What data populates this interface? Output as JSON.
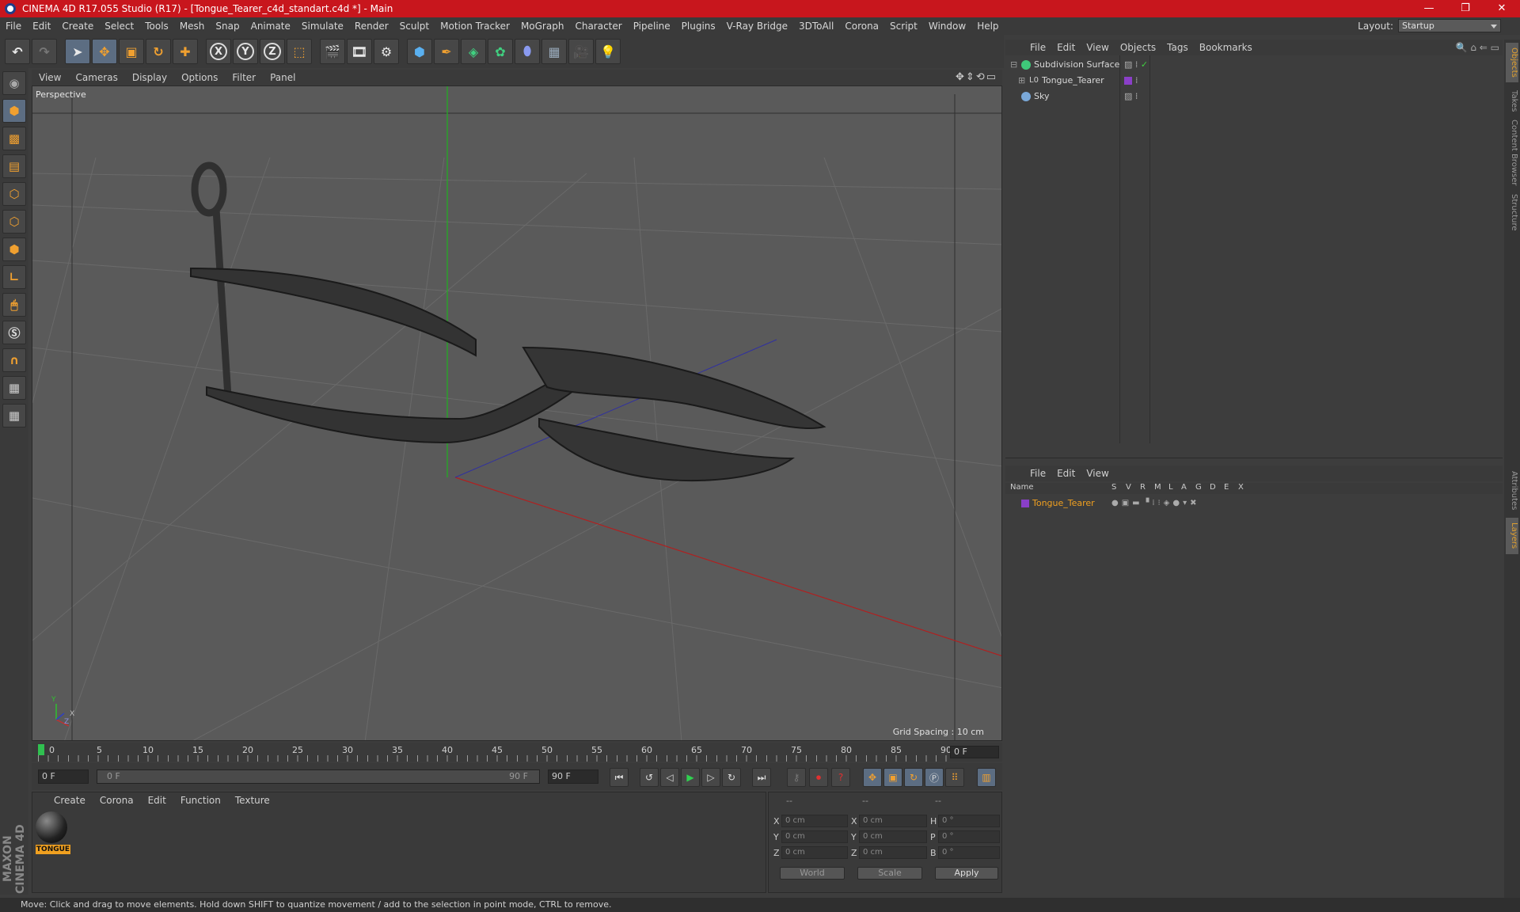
{
  "window": {
    "title": "CINEMA 4D R17.055 Studio (R17) - [Tongue_Tearer_c4d_standart.c4d *] - Main",
    "controls": [
      "—",
      "❐",
      "✕"
    ]
  },
  "menubar": {
    "items": [
      "File",
      "Edit",
      "Create",
      "Select",
      "Tools",
      "Mesh",
      "Snap",
      "Animate",
      "Simulate",
      "Render",
      "Sculpt",
      "Motion Tracker",
      "MoGraph",
      "Character",
      "Pipeline",
      "Plugins",
      "V-Ray Bridge",
      "3DToAll",
      "Corona",
      "Script",
      "Window",
      "Help"
    ],
    "layout_label": "Layout:",
    "layout_value": "Startup"
  },
  "toolbar": {
    "axis_x": "X",
    "axis_y": "Y",
    "axis_z": "Z"
  },
  "viewport": {
    "menu": [
      "View",
      "Cameras",
      "Display",
      "Options",
      "Filter",
      "Panel"
    ],
    "camera_label": "Perspective",
    "grid_spacing": "Grid Spacing : 10 cm",
    "axis_labels": {
      "y": "Y",
      "x": "X",
      "z": "Z"
    }
  },
  "timeline": {
    "ticks": [
      "0",
      "5",
      "10",
      "15",
      "20",
      "25",
      "30",
      "35",
      "40",
      "45",
      "50",
      "55",
      "60",
      "65",
      "70",
      "75",
      "80",
      "85",
      "90"
    ],
    "current_frame": "0 F"
  },
  "transport": {
    "start_field": "0 F",
    "range_start": "0 F",
    "range_end": "90 F",
    "end_field": "90 F"
  },
  "materials": {
    "menu": [
      "Create",
      "Corona",
      "Edit",
      "Function",
      "Texture"
    ],
    "items": [
      {
        "label": "TONGUE"
      }
    ]
  },
  "coords": {
    "headers": [
      "--",
      "--",
      "--"
    ],
    "rows": [
      {
        "a": "X",
        "av": "0 cm",
        "b": "X",
        "bv": "0 cm",
        "c": "H",
        "cv": "0 °"
      },
      {
        "a": "Y",
        "av": "0 cm",
        "b": "Y",
        "bv": "0 cm",
        "c": "P",
        "cv": "0 °"
      },
      {
        "a": "Z",
        "av": "0 cm",
        "b": "Z",
        "bv": "0 cm",
        "c": "B",
        "cv": "0 °"
      }
    ],
    "mode": "World",
    "scale": "Scale",
    "apply": "Apply"
  },
  "object_manager": {
    "menu": [
      "File",
      "Edit",
      "View",
      "Objects",
      "Tags",
      "Bookmarks"
    ],
    "objects": [
      {
        "name": "Subdivision Surface",
        "color": "#3fc87a"
      },
      {
        "name": "Tongue_Tearer",
        "color": "#8a3fc8"
      },
      {
        "name": "Sky",
        "color": "#7aa8d8"
      }
    ]
  },
  "layer_manager": {
    "menu": [
      "File",
      "Edit",
      "View"
    ],
    "columns": [
      "Name",
      "S",
      "V",
      "R",
      "M",
      "L",
      "A",
      "G",
      "D",
      "E",
      "X"
    ],
    "layers": [
      {
        "name": "Tongue_Tearer",
        "color": "#8a3fc8"
      }
    ]
  },
  "right_tabs": [
    "Objects",
    "Takes",
    "Content Browser",
    "Structure",
    "Attributes",
    "Layers"
  ],
  "status": "Move: Click and drag to move elements. Hold down SHIFT to quantize movement / add to the selection in point mode, CTRL to remove.",
  "brand": "MAXON CINEMA 4D",
  "colors": {
    "titlebar": "#c8161d",
    "accent": "#f0a020",
    "active_tool": "#5c6d82"
  }
}
